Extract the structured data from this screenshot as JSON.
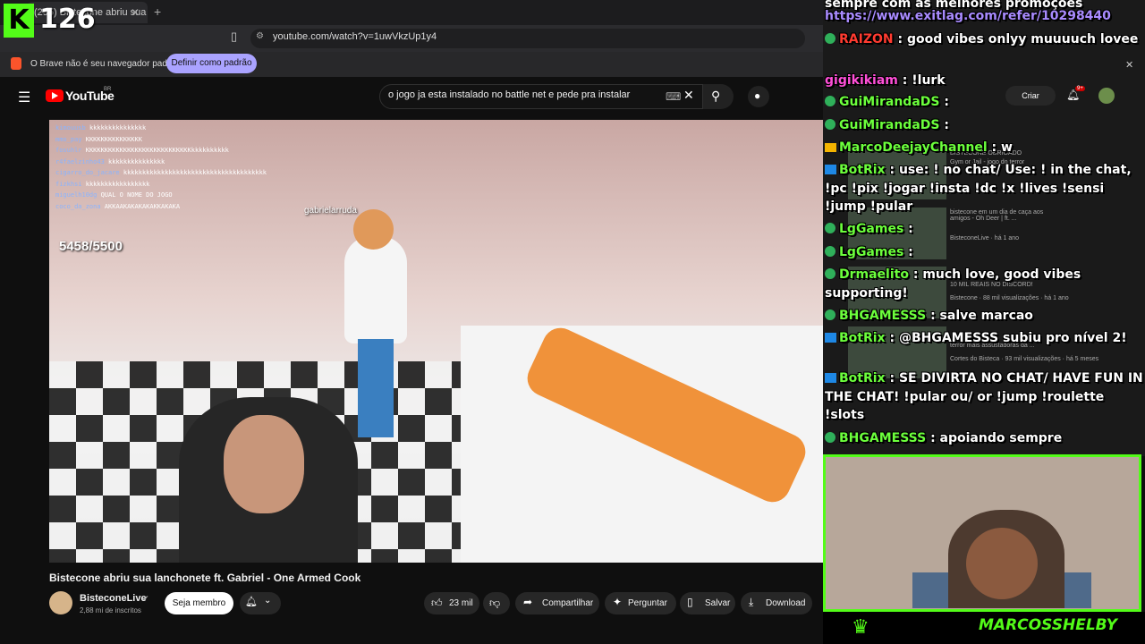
{
  "kick": {
    "logo": "K",
    "count": "126"
  },
  "browser": {
    "tab_title": "(295) Bistecone abriu sua la...",
    "url": "youtube.com/watch?v=1uwVkzUp1y4",
    "infobar_text": "O Brave não é seu navegador padrão",
    "default_button": "Definir como padrão"
  },
  "youtube": {
    "brand": "YouTube",
    "region": "BR",
    "search_query": "o jogo ja esta instalado no battle net e pede pra instalar",
    "video": {
      "kill_counter": "5458/5500",
      "player_tag": "gabrielarruda",
      "game_chat": [
        {
          "user": "kimouusb",
          "msg": "kkkkkkkkkkkkkkk"
        },
        {
          "user": "mmo_pay",
          "msg": "KKKKKKKKKKKKKKK"
        },
        {
          "user": "fosuhlr",
          "msg": "KKKKKKKKKKKKKKKKKKKKKKKKKKKKkkkkkkkkkk"
        },
        {
          "user": "r4faelzinho43",
          "msg": "kkkkkkkkkkkkkkk"
        },
        {
          "user": "cigarro_do_jacare",
          "msg": "kkkkkkkkkkkkkkkkkkkkkkkkkkkkkkkkkkkkkk"
        },
        {
          "user": "fizkhsi",
          "msg": "kkkkkkkkkkkkkkkkk"
        },
        {
          "user": "miguelh10dg",
          "msg": "QUAL O NOME DO JOGO"
        },
        {
          "user": "coco_da_zona",
          "msg": "AKKAAKAKAKAKAKKAKAKA"
        }
      ]
    },
    "title": "Bistecone abriu sua lanchonete ft. Gabriel - One Armed Cook",
    "channel": {
      "name": "BisteconeLive",
      "subs": "2,88 mi de inscritos"
    },
    "member_button": "Seja membro",
    "likes": "23 mil",
    "share": "Compartilhar",
    "ask": "Perguntar",
    "save": "Salvar",
    "download": "Download",
    "criar": "Criar",
    "notif_count": "9+",
    "recs": [
      {
        "title": "BISTECONE OBRIGADO",
        "meta": "Gym or Jail - jogo do terror"
      },
      {
        "title": "bistecone em um dia de caça aos amigos - Oh Deer | ft. ...",
        "meta": "BisteconeLive · há 1 ano"
      },
      {
        "title": "10 MIL REAIS NO DISCORD!",
        "meta": "Bistecone · 88 mil visualizações · há 1 ano"
      },
      {
        "title": "terror mais assustadoras da ...",
        "meta": "Cortes do Bisteca · 93 mil visualizações · há 5 meses"
      }
    ]
  },
  "chat": {
    "promo_text": "sempre com as melhores promoções",
    "promo_link": "https://www.exitlag.com/refer/10298440",
    "messages": [
      {
        "user": "RAIZON",
        "text": ": good vibes onlyy muuuuch lovee",
        "color": "u-red",
        "badge": "badge"
      },
      {
        "user": "gigikikiam",
        "text": ": !lurk",
        "color": "u-pink",
        "badge": "none"
      },
      {
        "user": "GuiMirandaDS",
        "text": ":",
        "color": "u-green",
        "badge": "badge"
      },
      {
        "user": "GuiMirandaDS",
        "text": ":",
        "color": "u-green",
        "badge": "badge"
      },
      {
        "user": "MarcoDeejayChannel",
        "text": ": w",
        "color": "u-green",
        "badge": "crown"
      },
      {
        "user": "BotRix",
        "text": ": use: ! no chat/ Use: ! in the chat, !pc !pix !jogar !insta !dc !x !lives !sensi !jump !pular",
        "color": "u-green",
        "badge": "bot"
      },
      {
        "user": "LgGames",
        "text": ":",
        "color": "u-green",
        "badge": "badge"
      },
      {
        "user": "LgGames",
        "text": ":",
        "color": "u-green",
        "badge": "badge"
      },
      {
        "user": "Drmaelito",
        "text": ": much love, good vibes supporting!",
        "color": "u-green",
        "badge": "badge"
      },
      {
        "user": "BHGAMESSS",
        "text": ": salve marcao",
        "color": "u-green",
        "badge": "badge"
      },
      {
        "user": "BotRix",
        "text": ": @BHGAMESSS subiu pro nível 2!",
        "color": "u-green",
        "badge": "bot"
      },
      {
        "user": "BotRix",
        "text": ": SE DIVIRTA NO CHAT/ HAVE FUN IN THE CHAT! !pular ou/ or !jump !roulette !slots",
        "color": "u-green",
        "badge": "bot"
      },
      {
        "user": "BHGAMESSS",
        "text": ": apoiando sempre",
        "color": "u-green",
        "badge": "badge"
      }
    ]
  },
  "streamer_name": "MARCOSSHELBY",
  "colors": {
    "kick_green": "#53fc18",
    "brave_orange": "#fb542b",
    "yt_red": "#ff0000"
  }
}
